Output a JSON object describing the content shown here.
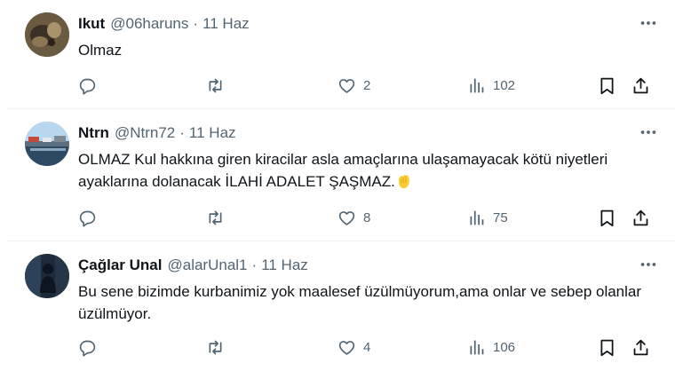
{
  "tweets": [
    {
      "display_name": "Ikut",
      "handle": "@06haruns",
      "separator": "·",
      "time": "11 Haz",
      "text": "Olmaz",
      "emoji": "",
      "likes": "2",
      "views": "102",
      "retweets": "",
      "replies": ""
    },
    {
      "display_name": "Ntrn",
      "handle": "@Ntrn72",
      "separator": "·",
      "time": "11 Haz",
      "text": "OLMAZ Kul hakkına giren kiracilar asla amaçlarına ulaşamayacak kötü niyetleri ayaklarına dolanacak İLAHİ ADALET ŞAŞMAZ.",
      "emoji": "clapping-hands",
      "likes": "8",
      "views": "75",
      "retweets": "",
      "replies": ""
    },
    {
      "display_name": "Çağlar Unal",
      "handle": "@alarUnal1",
      "separator": "·",
      "time": "11 Haz",
      "text": "Bu sene bizimde kurbanimiz yok maalesef üzülmüyorum,ama onlar ve sebep olanlar üzülmüyor.",
      "emoji": "",
      "likes": "4",
      "views": "106",
      "retweets": "",
      "replies": ""
    }
  ],
  "icons": {
    "more": "more-horizontal-icon",
    "reply": "reply-bubble-icon",
    "retweet": "retweet-icon",
    "like": "heart-icon",
    "views": "views-chart-icon",
    "bookmark": "bookmark-icon",
    "share": "share-upload-icon"
  },
  "colors": {
    "primary_text": "#0f1419",
    "secondary_text": "#536471",
    "divider": "#eff3f4",
    "emoji": "#ffcc33"
  }
}
